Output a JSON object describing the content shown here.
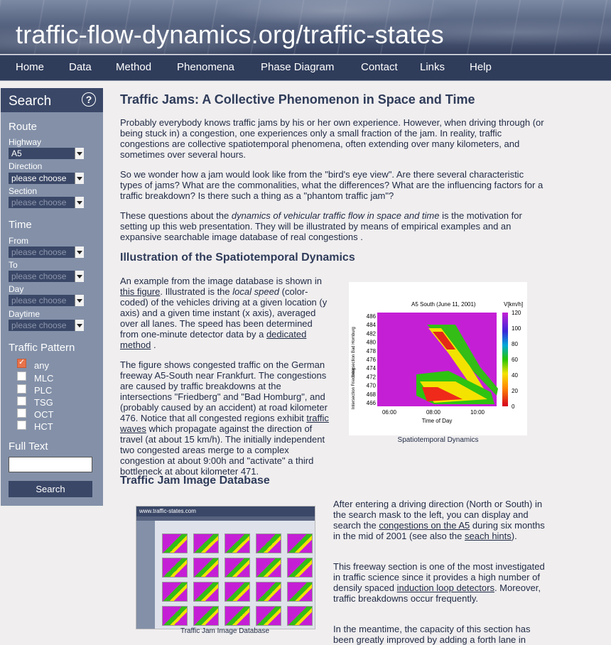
{
  "site": {
    "title": "traffic-flow-dynamics.org/traffic-states"
  },
  "nav": [
    "Home",
    "Data",
    "Method",
    "Phenomena",
    "Phase Diagram",
    "Contact",
    "Links",
    "Help"
  ],
  "sidebar": {
    "title": "Search",
    "help_icon": "?",
    "route": {
      "heading": "Route",
      "highway_label": "Highway",
      "highway_value": "A5",
      "direction_label": "Direction",
      "direction_value": "please choose",
      "section_label": "Section",
      "section_value": "please choose"
    },
    "time": {
      "heading": "Time",
      "from_label": "From",
      "from_value": "please choose",
      "to_label": "To",
      "to_value": "please choose",
      "day_label": "Day",
      "day_value": "please choose",
      "daytime_label": "Daytime",
      "daytime_value": "please choose"
    },
    "pattern": {
      "heading": "Traffic Pattern",
      "options": [
        {
          "label": "any",
          "checked": true
        },
        {
          "label": "MLC",
          "checked": false
        },
        {
          "label": "PLC",
          "checked": false
        },
        {
          "label": "TSG",
          "checked": false
        },
        {
          "label": "OCT",
          "checked": false
        },
        {
          "label": "HCT",
          "checked": false
        }
      ]
    },
    "fulltext": {
      "heading": "Full Text",
      "value": ""
    },
    "search_button": "Search"
  },
  "content": {
    "h1": "Traffic Jams: A Collective Phenomenon in Space and Time",
    "p1": "Probably everybody knows traffic jams by his or her own experience. However, when driving through (or being stuck in) a congestion, one experiences only a small fraction of the jam. In reality, traffic congestions are collective spatiotemporal phenomena, often extending over many kilometers, and sometimes over several hours.",
    "p2": "So we wonder how a jam would look like from the \"bird's eye view\". Are there several characteristic types of jams? What are the commonalities, what the differences? What are the influencing factors for a traffic breakdown? Is there such a thing as a \"phantom traffic jam\"?",
    "p3_a": "These questions about the ",
    "p3_b": "dynamics of vehicular traffic flow in space and time",
    "p3_c": " is the motivation for setting up this web presentation. They will be illustrated by means of empirical examples and an expansive searchable image database of real congestions .",
    "h2a": "Illustration of the Spatiotemporal Dynamics",
    "p4_a": "An example from the image database is shown in ",
    "p4_link1": "this figure",
    "p4_b": ". Illustrated is the ",
    "p4_c": "local speed",
    "p4_d": " (color-coded) of the vehicles driving at a given location (y axis) and a given time instant (x axis), averaged over all lanes. The speed has been determined from one-minute detector data by a ",
    "p4_link2": "dedicated method",
    "p4_e": " .",
    "p5_a": "The figure shows congested traffic on the German freeway A5-South near Frankfurt. The congestions are caused by traffic breakdowns at the intersections \"Friedberg\" and \"Bad Homburg\", and (probably caused by an accident) at road kilometer 476. Notice that all congested regions exhibit ",
    "p5_link": "traffic waves",
    "p5_b": " which propagate against the direction of travel (at about 15 km/h). The initially independent two congested areas merge to a complex congestion at about 9:00h and \"activate\" a third bottleneck at about kilometer 471.",
    "fig_caption": "Spatiotemporal Dynamics",
    "h2b": "Traffic Jam Image Database",
    "p6_a": "After entering a driving direction (North or South) in the search mask to the left, you can display and search the ",
    "p6_link1": "congestions on the A5",
    "p6_b": " during six months in the mid of 2001 (see also the ",
    "p6_link2": "seach hints",
    "p6_c": ").",
    "p7_a": "This freeway section is one of the most investigated in traffic science since it provides a high number of densily spaced ",
    "p7_link": "induction loop detectors",
    "p7_b": ". Moreover, traffic breakdowns occur frequently.",
    "p8": "In the meantime, the capacity of this section has been greatly improved by adding a forth lane in",
    "shot_caption": "Traffic Jam Image Database",
    "shot_url": "www.traffic-states.com"
  },
  "chart_data": {
    "type": "heatmap",
    "title": "A5 South (June 11, 2001)",
    "xlabel": "Time of Day",
    "ylabel": "",
    "x_ticks": [
      "06:00",
      "08:00",
      "10:00"
    ],
    "y_ticks": [
      486,
      484,
      482,
      480,
      478,
      476,
      474,
      472,
      470,
      468,
      466
    ],
    "colorbar_label": "V[km/h]",
    "colorbar_ticks": [
      120,
      100,
      80,
      60,
      40,
      20,
      0
    ],
    "annotations": [
      "Intersection Bad Homburg",
      "Intersection Friedberg"
    ]
  }
}
